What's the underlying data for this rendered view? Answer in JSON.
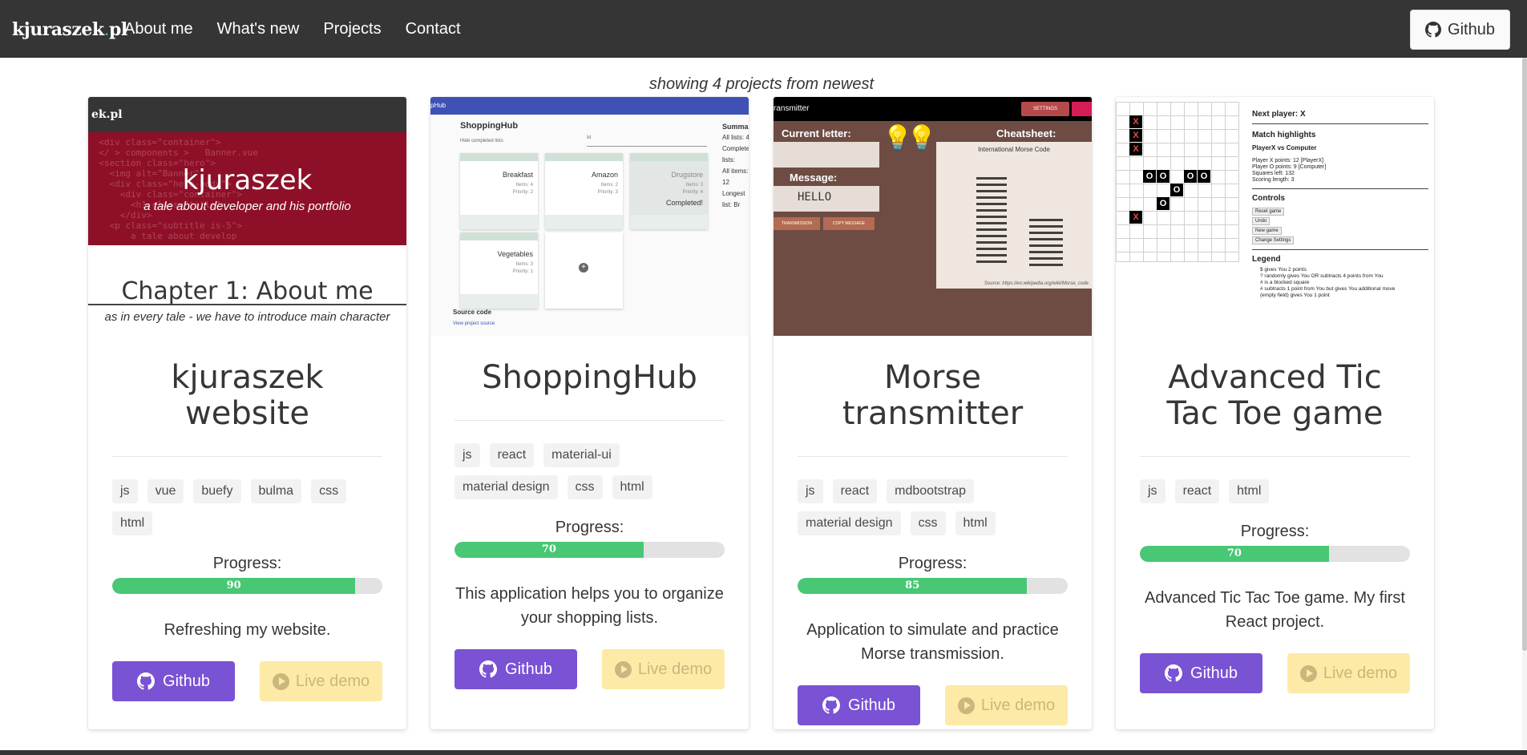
{
  "nav": {
    "brand_left": "kjuraszek",
    "brand_dot": ".",
    "brand_right": "pl",
    "links": [
      "About me",
      "What's new",
      "Projects",
      "Contact"
    ],
    "github": "Github"
  },
  "subtitle": "showing 4 projects from newest",
  "common": {
    "progress_label": "Progress:",
    "github_label": "Github",
    "demo_label": "Live demo"
  },
  "colors": {
    "navbar": "#353535",
    "github_button": "#7a52d4",
    "demo_button": "#fdeaa6",
    "progress_fill": "#48c774"
  },
  "projects": [
    {
      "title": "kjuraszek website",
      "tags": [
        "js",
        "vue",
        "buefy",
        "bulma",
        "css",
        "html"
      ],
      "progress": 90,
      "description": "Refreshing my website.",
      "screenshot": {
        "brand": "ek.pl",
        "headline": "kjuraszek",
        "tagline": "a tale about developer and his portfolio",
        "chapter": "Chapter 1: About me",
        "chapter_sub": "as in every tale - we have to introduce main character"
      }
    },
    {
      "title": "ShoppingHub",
      "tags": [
        "js",
        "react",
        "material-ui",
        "material design",
        "css",
        "html"
      ],
      "progress": 70,
      "description": "This application helps you to organize your shopping lists.",
      "screenshot": {
        "top": "pHub",
        "title": "ShoppingHub",
        "toggle": "Hide completed lists",
        "sort": "Id",
        "summary_title": "Summary",
        "summary": [
          "All lists: 4",
          "Completed lists:",
          "All items: 12",
          "Longest list: Br"
        ],
        "lists": [
          {
            "name": "Breakfast",
            "items": "Items: 4",
            "priority": "Priority: 2"
          },
          {
            "name": "Amazon",
            "items": "Items: 2",
            "priority": "Priority: 3"
          },
          {
            "name": "Drugstore",
            "items": "Items: 3",
            "priority": "Priority: 4",
            "status": "Completed!"
          },
          {
            "name": "Vegetables",
            "items": "Items: 3",
            "priority": "Priority: 1"
          }
        ],
        "source_title": "Source code",
        "source_link": "View project source"
      }
    },
    {
      "title": "Morse transmitter",
      "tags": [
        "js",
        "react",
        "mdbootstrap",
        "material design",
        "css",
        "html"
      ],
      "progress": 85,
      "description": "Application to simulate and practice Morse transmission.",
      "screenshot": {
        "top": "ransmitter",
        "settings": "SETTINGS",
        "current_letter": "Current letter:",
        "message_label": "Message:",
        "message": "HELLO",
        "cheatsheet": "Cheatsheet:",
        "sheet_title": "International Morse Code",
        "btn_transmission": "TRANSMISSION",
        "btn_copy": "COPY MESSAGE",
        "source": "Source: https://en.wikipedia.org/wiki/Morse_code"
      }
    },
    {
      "title": "Advanced Tic Tac Toe game",
      "tags": [
        "js",
        "react",
        "html"
      ],
      "progress": 70,
      "description": "Advanced Tic Tac Toe game. My first React project.",
      "screenshot": {
        "next_player": "Next player: X",
        "highlights": "Match highlights",
        "match": "PlayerX vs Computer",
        "stats": [
          "Player X points: 12 [PlayerX]",
          "Player O points: 9 [Computer]",
          "Squares left: 132",
          "Scoring length: 3"
        ],
        "controls": "Controls",
        "control_buttons": [
          "Reset game",
          "Undo",
          "New game",
          "Change Settings"
        ],
        "legend": "Legend",
        "legend_items": [
          "$ gives You 2 points",
          "? randomly gives You OR subtracts 4 points from You",
          "# is a blocked square",
          "# subtracts 1 point from You but gives You additional move",
          "(empty field) gives You 1 point"
        ]
      }
    }
  ]
}
